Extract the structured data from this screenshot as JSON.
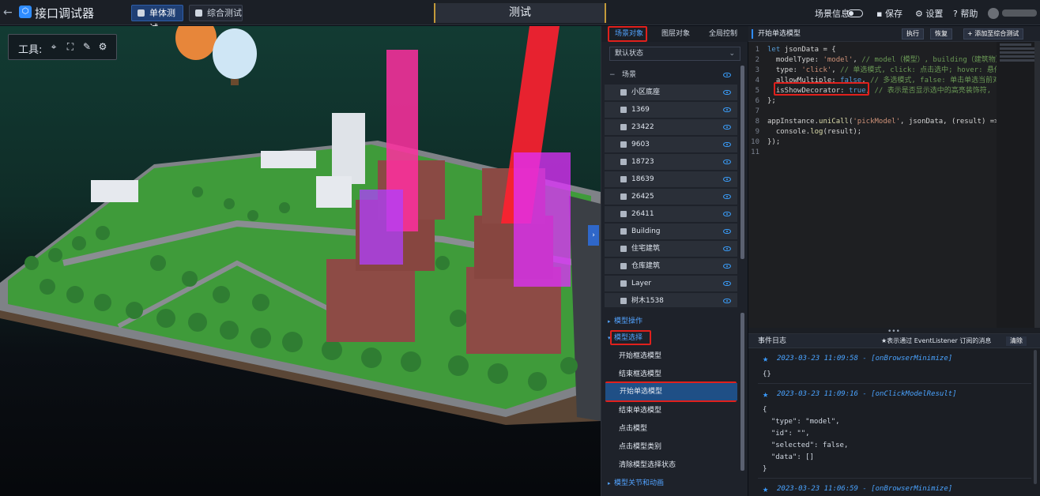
{
  "topbar": {
    "title": "接口调试器",
    "tab_single": "单体测试",
    "tab_combined": "综合测试",
    "center_title": "测试",
    "scene_info": "场景信息",
    "save": "保存",
    "settings": "设置",
    "help": "帮助"
  },
  "tools": {
    "label": "工具:"
  },
  "middle": {
    "tabs": [
      "场景对象",
      "图层对象",
      "全局控制"
    ],
    "state_select": "默认状态",
    "scene_root": "场景",
    "tree_items": [
      "小区底座",
      "1369",
      "23422",
      "9603",
      "18723",
      "18639",
      "26425",
      "26411",
      "Building",
      "住宅建筑",
      "仓库建筑",
      "Layer",
      "树木1538"
    ],
    "section_model_ops": "模型操作",
    "section_model_select": "模型选择",
    "select_items": [
      "开始框选模型",
      "结束框选模型",
      "开始单选模型",
      "结束单选模型",
      "点击模型",
      "点击模型类别",
      "清除模型选择状态"
    ],
    "section_joints": "模型关节和动画"
  },
  "right": {
    "header": "开始单选模型",
    "run": "执行",
    "restore": "恢复",
    "add_combined": "添加至综合测试",
    "code_lines": [
      "let jsonData = {",
      "  modelType: 'model', // model（模型）, building（建筑物）",
      "  type: 'click', // 单选模式, click: 点击选中; hover: 悬停",
      "  allowMultiple: false, // 多选模式, false: 单击单选当前对",
      "  isShowDecorator: true, // 表示是否显示选中的高亮装饰符,",
      "};",
      "",
      "appInstance.uniCall('pickModel', jsonData, (result) => {",
      "  console.log(result);",
      "});",
      ""
    ],
    "log_title": "事件日志",
    "log_hint": "★表示通过 EventListener 订阅的消息",
    "clear": "清除",
    "log_entries": [
      {
        "time": "2023-03-23 11:09:58 - [onBrowserMinimize]",
        "body": [
          "{}"
        ]
      },
      {
        "time": "2023-03-23 11:09:16 - [onClickModelResult]",
        "body": [
          "{",
          "  \"type\": \"model\",",
          "  \"id\": \"\",",
          "  \"selected\": false,",
          "  \"data\": []",
          "}"
        ]
      },
      {
        "time": "2023-03-23 11:06:59 - [onBrowserMinimize]",
        "body": [
          "{}"
        ]
      }
    ]
  },
  "colors": {
    "accent": "#2f8cff",
    "highlight_box": "#e0201c",
    "selected_item": "#1f4f86"
  }
}
